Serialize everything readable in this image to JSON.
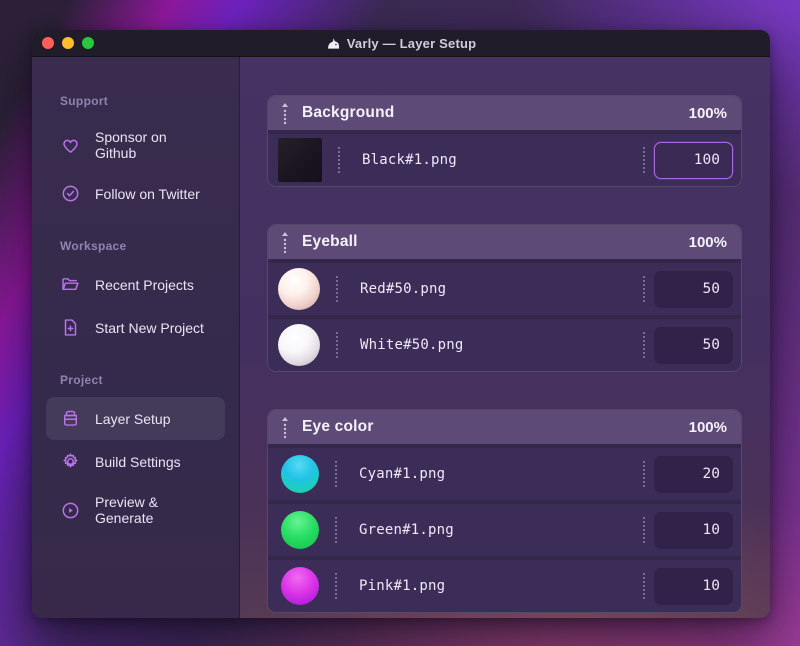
{
  "window": {
    "title": "Varly — Layer Setup",
    "app_icon": "unicorn",
    "traffic_lights": {
      "close": "#ff5f57",
      "minimize": "#febc2e",
      "zoom": "#28c840"
    }
  },
  "sidebar": {
    "sections": [
      {
        "label": "Support",
        "items": [
          {
            "label": "Sponsor on Github",
            "icon": "heart-icon"
          },
          {
            "label": "Follow on Twitter",
            "icon": "verified-badge-icon"
          }
        ]
      },
      {
        "label": "Workspace",
        "items": [
          {
            "label": "Recent Projects",
            "icon": "folder-open-icon"
          },
          {
            "label": "Start New Project",
            "icon": "file-plus-icon"
          }
        ]
      },
      {
        "label": "Project",
        "items": [
          {
            "label": "Layer Setup",
            "icon": "archive-box-icon",
            "active": true
          },
          {
            "label": "Build Settings",
            "icon": "gear-icon"
          },
          {
            "label": "Preview & Generate",
            "icon": "play-circle-icon"
          }
        ]
      }
    ]
  },
  "layer_setup": {
    "groups": [
      {
        "name": "Background",
        "weight": "100%",
        "layers": [
          {
            "file": "Black#1.png",
            "value": "100",
            "thumbnail": "black-swatch",
            "focused": true
          }
        ]
      },
      {
        "name": "Eyeball",
        "weight": "100%",
        "layers": [
          {
            "file": "Red#50.png",
            "value": "50",
            "thumbnail": "red-sphere"
          },
          {
            "file": "White#50.png",
            "value": "50",
            "thumbnail": "white-sphere"
          }
        ]
      },
      {
        "name": "Eye color",
        "weight": "100%",
        "layers": [
          {
            "file": "Cyan#1.png",
            "value": "20",
            "thumbnail": "cyan-sphere"
          },
          {
            "file": "Green#1.png",
            "value": "10",
            "thumbnail": "green-sphere"
          },
          {
            "file": "Pink#1.png",
            "value": "10",
            "thumbnail": "pink-sphere"
          }
        ]
      }
    ]
  },
  "colors": {
    "accent": "#b873ec",
    "focus_border": "#a968e4",
    "sidebar_bg": "#372a4d",
    "main_bg": "#443060",
    "group_header_bg": "#5d4a76",
    "row_bg": "#3c2c58",
    "titlebar_bg": "#211c29",
    "traffic_red": "#ff5f57",
    "traffic_yellow": "#febc2e",
    "traffic_green": "#28c840",
    "thumb_black": "#1a141f",
    "thumb_cyan": "#22c2e6",
    "thumb_green": "#27dd62",
    "thumb_pink": "#dd35e6"
  }
}
